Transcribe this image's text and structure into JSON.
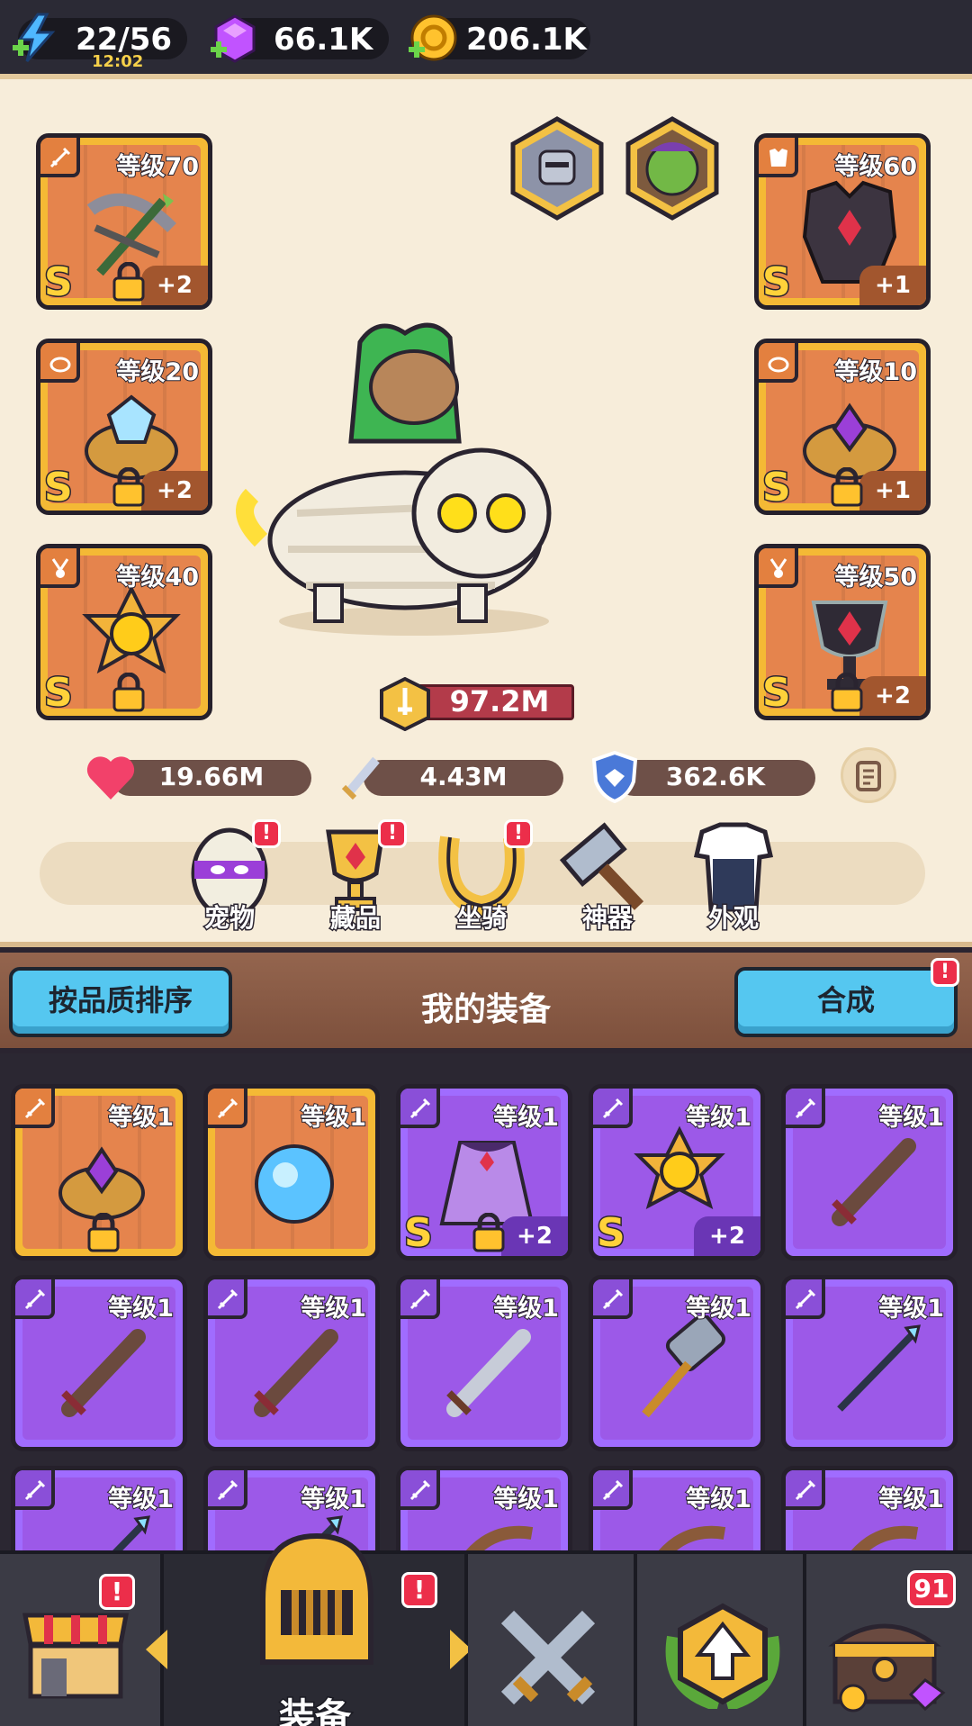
{
  "resources": {
    "energy": {
      "value": "22/56",
      "timer": "12:02",
      "icon": "lightning-icon"
    },
    "gems": {
      "value": "66.1K",
      "icon": "gem-icon"
    },
    "gold": {
      "value": "206.1K",
      "icon": "gold-coin-icon"
    }
  },
  "equipped": {
    "weapon": {
      "level": "等级70",
      "grade": "S",
      "plus": "+2",
      "icon": "crossbow-icon"
    },
    "armor": {
      "level": "等级60",
      "grade": "S",
      "plus": "+1",
      "icon": "armor-icon"
    },
    "ring_left": {
      "level": "等级20",
      "grade": "S",
      "plus": "+2",
      "icon": "ring-icon"
    },
    "ring_right": {
      "level": "等级10",
      "grade": "S",
      "plus": "+1",
      "icon": "ring-icon"
    },
    "necklace": {
      "level": "等级40",
      "grade": "S",
      "icon": "amulet-icon"
    },
    "chalice": {
      "level": "等级50",
      "grade": "S",
      "plus": "+2",
      "icon": "chalice-icon"
    }
  },
  "companions": [
    "knight-avatar-icon",
    "orc-avatar-icon"
  ],
  "power": {
    "value": "97.2M"
  },
  "stats": {
    "hp": "19.66M",
    "attack": "4.43M",
    "defense": "362.6K"
  },
  "features": [
    {
      "label": "宠物",
      "badge": "!",
      "icon": "pet-egg-icon"
    },
    {
      "label": "藏品",
      "badge": "!",
      "icon": "trophy-icon"
    },
    {
      "label": "坐骑",
      "badge": "!",
      "icon": "horseshoe-icon"
    },
    {
      "label": "神器",
      "icon": "hammer-icon"
    },
    {
      "label": "外观",
      "icon": "outfit-icon"
    }
  ],
  "section": {
    "sort_label": "按品质排序",
    "title": "我的装备",
    "merge_label": "合成",
    "merge_badge": "!"
  },
  "inventory": [
    {
      "level": "等级1",
      "rarity": "orange",
      "icon": "ring-icon",
      "lock": true
    },
    {
      "level": "等级1",
      "rarity": "orange",
      "icon": "orb-icon"
    },
    {
      "level": "等级1",
      "rarity": "purple",
      "icon": "cape-icon",
      "grade": "S",
      "plus": "+2",
      "lock": true
    },
    {
      "level": "等级1",
      "rarity": "purple",
      "icon": "amulet-icon",
      "grade": "S",
      "plus": "+2"
    },
    {
      "level": "等级1",
      "rarity": "purple",
      "icon": "wooden-sword-icon"
    },
    {
      "level": "等级1",
      "rarity": "purple",
      "icon": "wooden-sword-icon"
    },
    {
      "level": "等级1",
      "rarity": "purple",
      "icon": "wooden-sword-icon"
    },
    {
      "level": "等级1",
      "rarity": "purple",
      "icon": "steel-sword-icon"
    },
    {
      "level": "等级1",
      "rarity": "purple",
      "icon": "hammer-icon"
    },
    {
      "level": "等级1",
      "rarity": "purple",
      "icon": "spear-icon"
    },
    {
      "level": "等级1",
      "rarity": "purple",
      "icon": "spear-icon"
    },
    {
      "level": "等级1",
      "rarity": "purple",
      "icon": "spear-icon"
    },
    {
      "level": "等级1",
      "rarity": "purple",
      "icon": "bow-icon"
    },
    {
      "level": "等级1",
      "rarity": "purple",
      "icon": "bow-icon"
    },
    {
      "level": "等级1",
      "rarity": "purple",
      "icon": "bow-icon"
    }
  ],
  "nav": {
    "shop_badge": "!",
    "equip_label": "装备",
    "equip_badge": "!",
    "chest_count": "91"
  }
}
